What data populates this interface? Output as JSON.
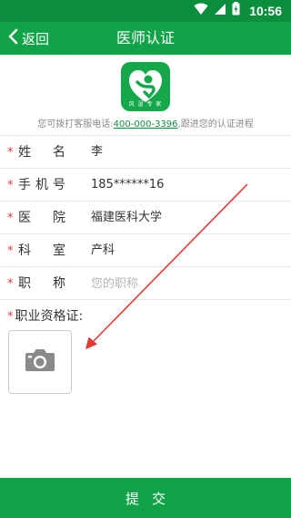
{
  "status_bar": {
    "time": "10:56",
    "icons": [
      "wifi-icon",
      "signal-icon",
      "battery-icon"
    ]
  },
  "header": {
    "back_label": "返回",
    "title": "医师认证"
  },
  "logo": {
    "text": "风 湿 专 家"
  },
  "hotline": {
    "prefix": "您可拨打客服电话:",
    "number": "400-000-3396",
    "suffix": ",跟进您的认证进程"
  },
  "form": {
    "rows": [
      {
        "label_chars": [
          "姓",
          "名"
        ],
        "value": "李",
        "required": true
      },
      {
        "label_chars": [
          "手",
          "机",
          "号"
        ],
        "value": "185******16",
        "required": true
      },
      {
        "label_chars": [
          "医",
          "院"
        ],
        "value": "福建医科大学",
        "required": true
      },
      {
        "label_chars": [
          "科",
          "室"
        ],
        "value": "产科",
        "required": true
      },
      {
        "label_chars": [
          "职",
          "称"
        ],
        "value": "",
        "placeholder": "您的职称",
        "required": true
      }
    ]
  },
  "certificate": {
    "label": "职业资格证:",
    "upload_icon": "camera-icon"
  },
  "footer": {
    "submit_label": "提交"
  },
  "colors": {
    "status_bar": "#0b8f3c",
    "brand_green": "#11a347",
    "required_star": "#e63946",
    "annotation_arrow": "#e53935"
  }
}
